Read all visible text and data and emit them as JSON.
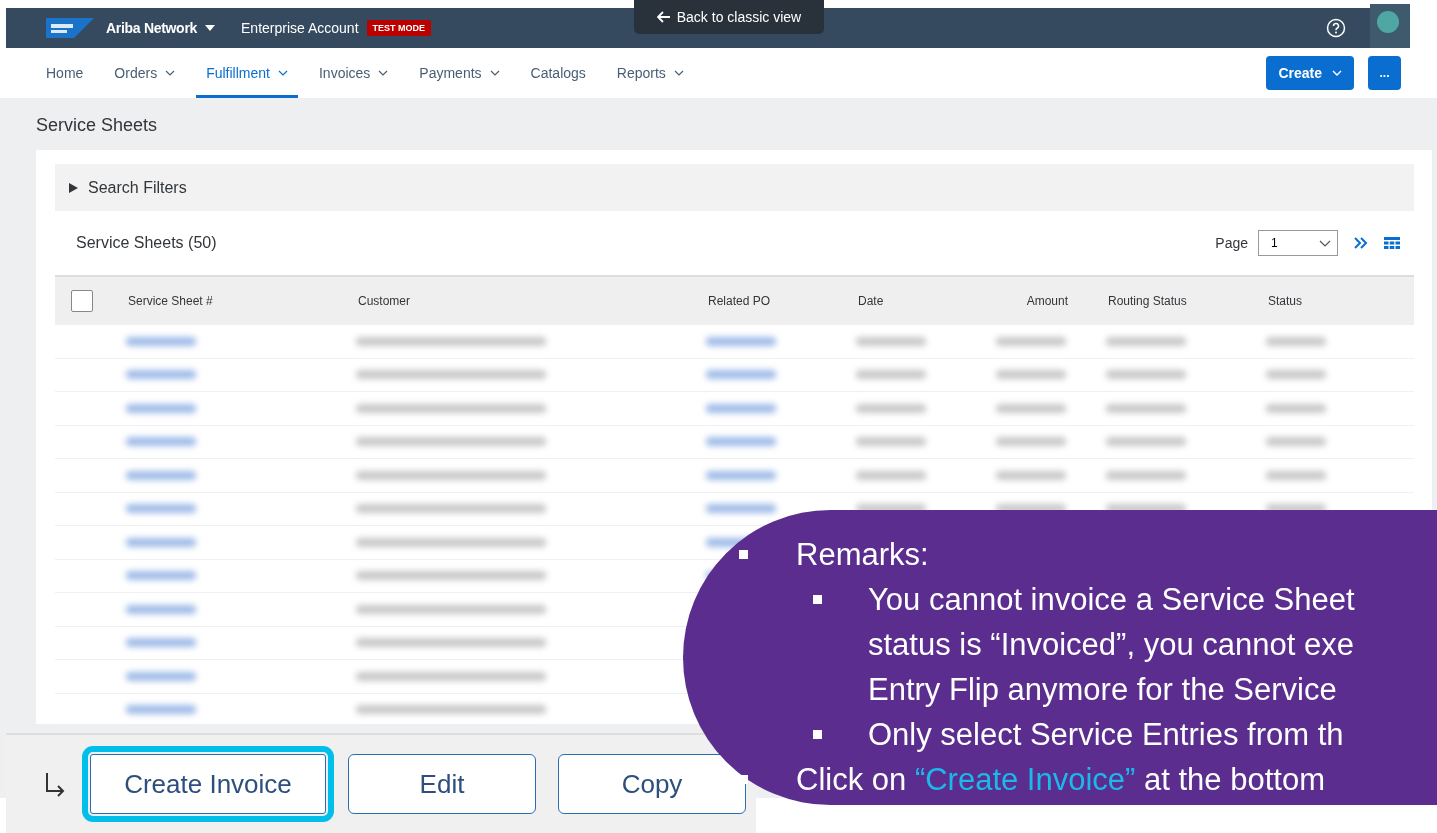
{
  "header": {
    "product": "Ariba Network",
    "account": "Enterprise Account",
    "mode_badge": "TEST MODE",
    "back_link": "Back to classic view"
  },
  "nav": {
    "items": [
      {
        "label": "Home",
        "dropdown": false,
        "selected": false
      },
      {
        "label": "Orders",
        "dropdown": true,
        "selected": false
      },
      {
        "label": "Fulfillment",
        "dropdown": true,
        "selected": true
      },
      {
        "label": "Invoices",
        "dropdown": true,
        "selected": false
      },
      {
        "label": "Payments",
        "dropdown": true,
        "selected": false
      },
      {
        "label": "Catalogs",
        "dropdown": false,
        "selected": false
      },
      {
        "label": "Reports",
        "dropdown": true,
        "selected": false
      }
    ],
    "create_button": "Create",
    "more_button": "..."
  },
  "page_title": "Service Sheets",
  "filters": {
    "label": "Search Filters",
    "expanded": false
  },
  "table": {
    "title": "Service Sheets (50)",
    "page_label": "Page",
    "page_value": "1",
    "columns": [
      "Service Sheet #",
      "Customer",
      "Related PO",
      "Date",
      "Amount",
      "Routing Status",
      "Status"
    ],
    "all_checked": false,
    "rows": [
      {
        "kind": "blurred"
      },
      {
        "kind": "blurred"
      },
      {
        "kind": "blurred"
      },
      {
        "kind": "blurred"
      },
      {
        "kind": "blurred"
      },
      {
        "kind": "blurred"
      },
      {
        "kind": "blurred"
      },
      {
        "kind": "blurred"
      },
      {
        "kind": "blurred"
      },
      {
        "kind": "blurred"
      },
      {
        "kind": "blurred"
      },
      {
        "kind": "blurred"
      }
    ]
  },
  "actions": [
    {
      "label": "Create Invoice",
      "highlighted": true
    },
    {
      "label": "Edit",
      "highlighted": false
    },
    {
      "label": "Copy",
      "highlighted": false
    }
  ],
  "callout": {
    "items": [
      {
        "text": "Remarks:",
        "children": [
          {
            "text": "You cannot invoice a Service Sheet"
          },
          {
            "text": "status is “Invoiced”, you cannot exe",
            "continuation": true
          },
          {
            "text": "Entry Flip anymore for the Service",
            "continuation": true
          },
          {
            "text": "Only select Service Entries from th"
          }
        ]
      },
      {
        "text": "Click on **“Create Invoice”** at the bottom"
      }
    ]
  }
}
